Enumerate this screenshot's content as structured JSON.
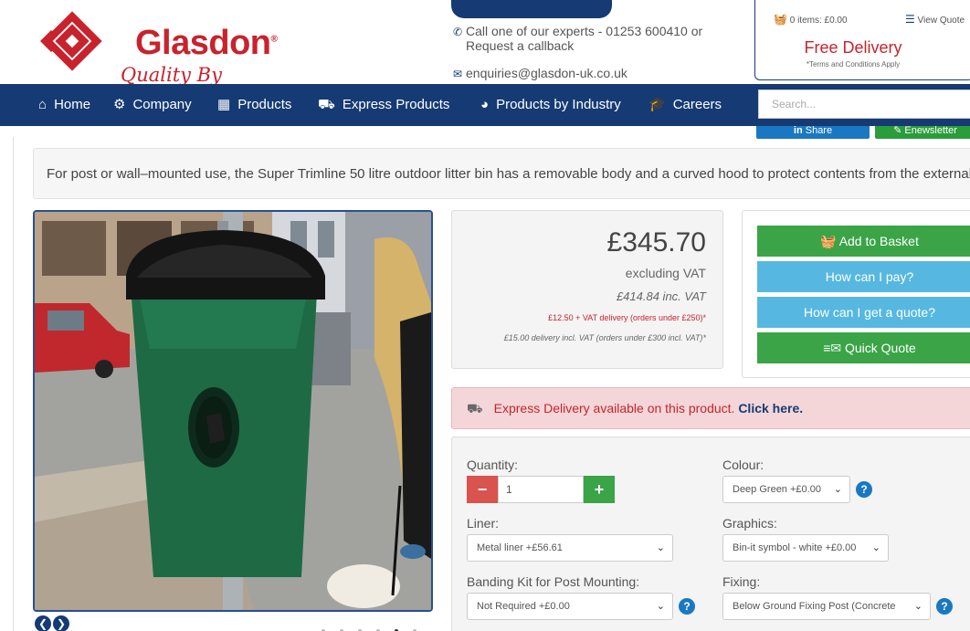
{
  "header": {
    "logo_name": "Glasdon",
    "logo_reg": "®",
    "logo_tagline": "Quality By Design",
    "phone_line_1": "Call one of our experts - 01253 600410 or",
    "phone_line_2": "Request a callback",
    "email": "enquiries@glasdon-uk.co.uk",
    "basket": "0 items: £0.00",
    "view_quote": "View Quote",
    "free_delivery": "Free Delivery",
    "terms": "*Terms and Conditions Apply"
  },
  "nav": {
    "items": [
      {
        "label": "Home",
        "icon": "home-icon"
      },
      {
        "label": "Company",
        "icon": "cogs-icon"
      },
      {
        "label": "Products",
        "icon": "grid-icon"
      },
      {
        "label": "Express Products",
        "icon": "truck-icon"
      },
      {
        "label": "Products by Industry",
        "icon": "pie-chart-icon"
      },
      {
        "label": "Careers",
        "icon": "graduation-cap-icon"
      }
    ],
    "search_placeholder": "Search...",
    "share": "Share",
    "enewsletter": "Enewsletter"
  },
  "description": "For post or wall–mounted use, the Super Trimline 50 litre outdoor litter bin has a removable body and a curved hood to protect contents from the external elements.",
  "price": {
    "amount": "£345.70",
    "ex_vat": "excluding VAT",
    "inc_vat": "£414.84 inc. VAT",
    "delivery_1": "£12.50 + VAT delivery (orders under £250)*",
    "delivery_2": "£15.00 delivery incl. VAT (orders under £300 incl. VAT)*"
  },
  "actions": {
    "add_to_basket": "Add to Basket",
    "how_pay": "How can I pay?",
    "how_quote": "How can I get a quote?",
    "quick_quote": "Quick Quote"
  },
  "express": {
    "text": "Express Delivery available on this product.",
    "link": "Click here."
  },
  "options": {
    "quantity_label": "Quantity:",
    "quantity_value": "1",
    "colour_label": "Colour:",
    "colour_value": "Deep Green +£0.00",
    "liner_label": "Liner:",
    "liner_value": "Metal liner +£56.61",
    "graphics_label": "Graphics:",
    "graphics_value": "Bin-it symbol - white +£0.00",
    "banding_label": "Banding Kit for Post Mounting:",
    "banding_value": "Not Required +£0.00",
    "fixing_label": "Fixing:",
    "fixing_value": "Below Ground Fixing Post (Concrete"
  },
  "carousel": {
    "dot_count": 6,
    "active_index": 4
  },
  "colors": {
    "brand_red": "#c8232c",
    "nav_blue": "#163a73",
    "green": "#3aa447",
    "light_blue": "#56b8e0"
  }
}
